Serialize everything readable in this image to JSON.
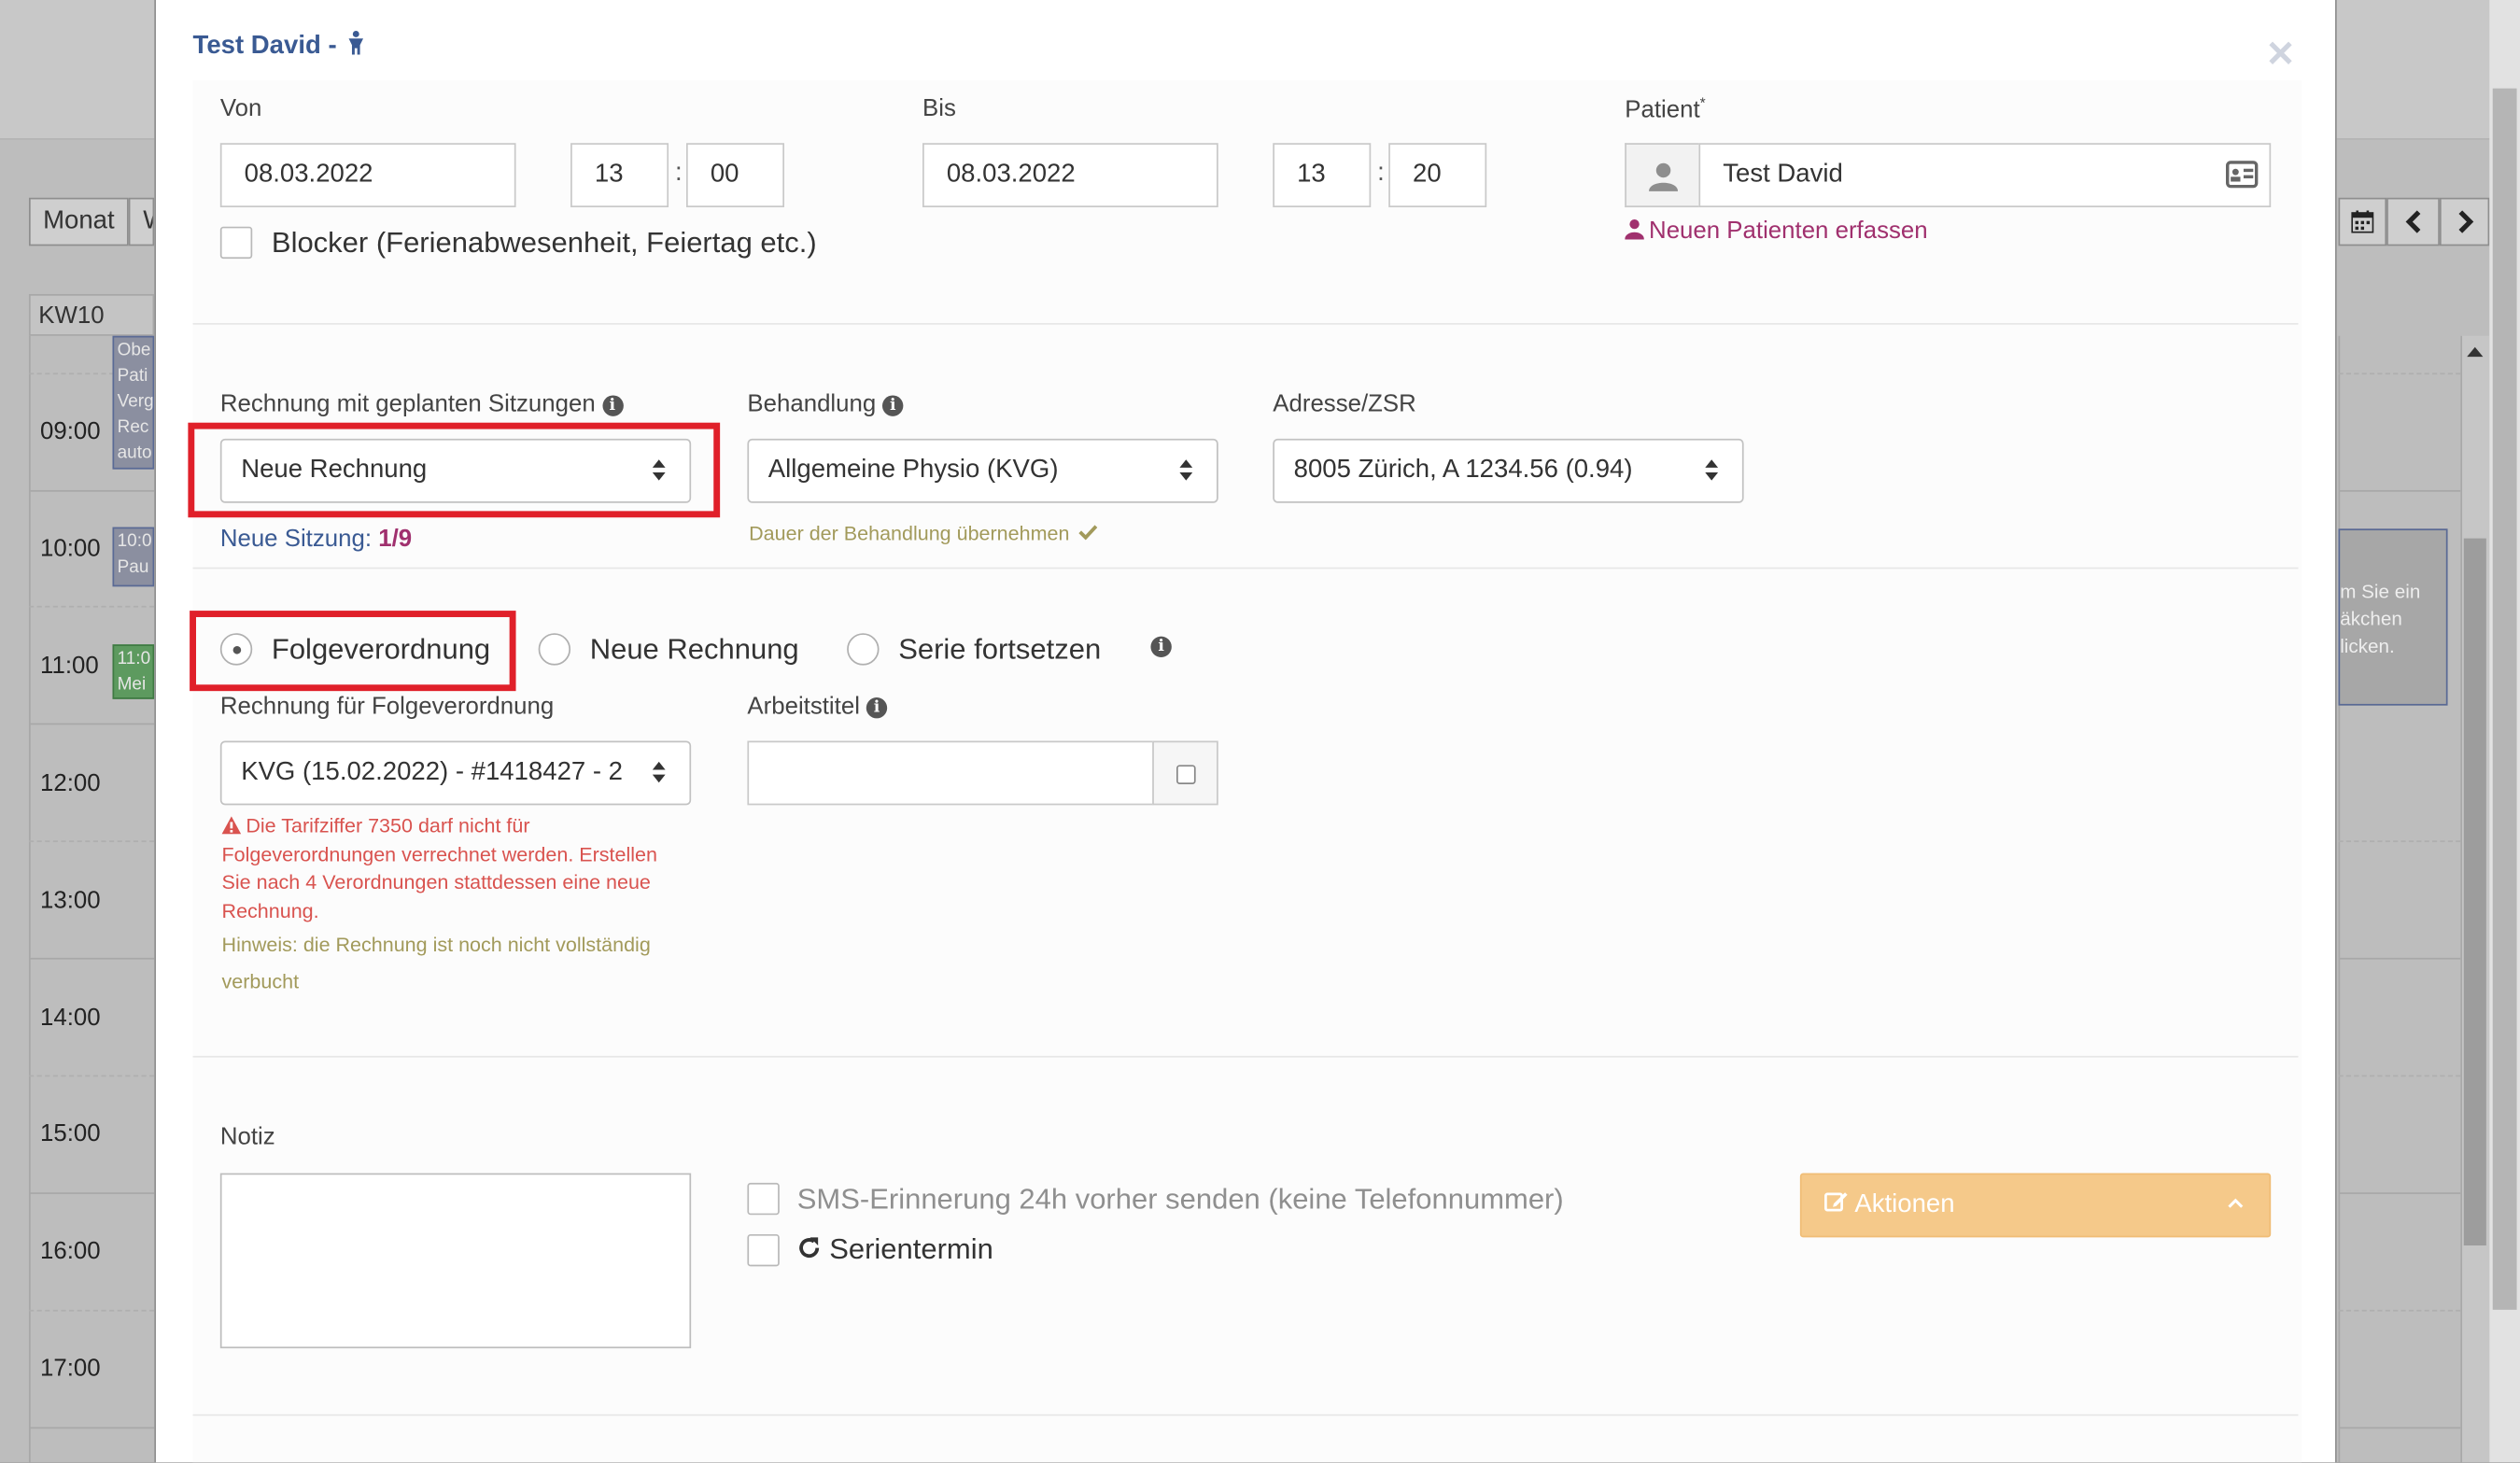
{
  "background": {
    "view_buttons": [
      "Monat",
      "W"
    ],
    "week_label": "KW10",
    "hours": [
      "09:00",
      "10:00",
      "11:00",
      "12:00",
      "13:00",
      "14:00",
      "15:00",
      "16:00",
      "17:00"
    ],
    "event_snippets": [
      "Obe",
      "Pati",
      "Verg",
      "Rec",
      "auto",
      "10:0",
      "Pau",
      "11:0",
      "Mei"
    ],
    "side_text": [
      "m Sie ein",
      "äkchen",
      "licken."
    ]
  },
  "modal": {
    "title": "Test David -",
    "close_icon": "times-icon",
    "von": {
      "label": "Von",
      "date": "08.03.2022",
      "hour": "13",
      "minute": "00"
    },
    "bis": {
      "label": "Bis",
      "date": "08.03.2022",
      "hour": "13",
      "minute": "20"
    },
    "time_separator": ":",
    "blocker_label": "Blocker (Ferienabwesenheit, Feiertag etc.)",
    "patient": {
      "label": "Patient",
      "required_mark": "*",
      "value": "Test David",
      "new_patient_link": "Neuen Patienten erfassen"
    },
    "rechnung": {
      "label": "Rechnung mit geplanten Sitzungen",
      "value": "Neue Rechnung",
      "session_label": "Neue Sitzung:",
      "session_value": "1/9"
    },
    "behandlung": {
      "label": "Behandlung",
      "value": "Allgemeine Physio (KVG)",
      "duration_hint": "Dauer der Behandlung übernehmen"
    },
    "adresse": {
      "label": "Adresse/ZSR",
      "value": "8005 Zürich, A 1234.56 (0.94)"
    },
    "radios": {
      "folgeverordnung": "Folgeverordnung",
      "neue_rechnung": "Neue Rechnung",
      "serie_fortsetzen": "Serie fortsetzen",
      "selected": "folgeverordnung"
    },
    "folge_rechnung": {
      "label": "Rechnung für Folgeverordnung",
      "value": "KVG (15.02.2022) - #1418427 - 2"
    },
    "arbeitstitel": {
      "label": "Arbeitstitel",
      "value": ""
    },
    "warning": [
      "Die Tarifziffer 7350 darf nicht für",
      "Folgeverordnungen verrechnet werden. Erstellen",
      "Sie nach 4 Verordnungen stattdessen eine neue",
      "Rechnung."
    ],
    "hint": [
      "Hinweis: die Rechnung ist noch nicht vollständig",
      "verbucht"
    ],
    "notiz": {
      "label": "Notiz",
      "value": ""
    },
    "sms_label": "SMS-Erinnerung 24h vorher senden (keine Telefonnummer)",
    "serientermin_label": "Serientermin",
    "actions_label": "Aktionen"
  },
  "colors": {
    "title_blue": "#3a5a93",
    "link_purple": "#a0306e",
    "highlight_red": "#e0202a",
    "warning_red": "#d9534f",
    "hint_olive": "#a29a5b",
    "actions_orange": "#f5c98a"
  }
}
